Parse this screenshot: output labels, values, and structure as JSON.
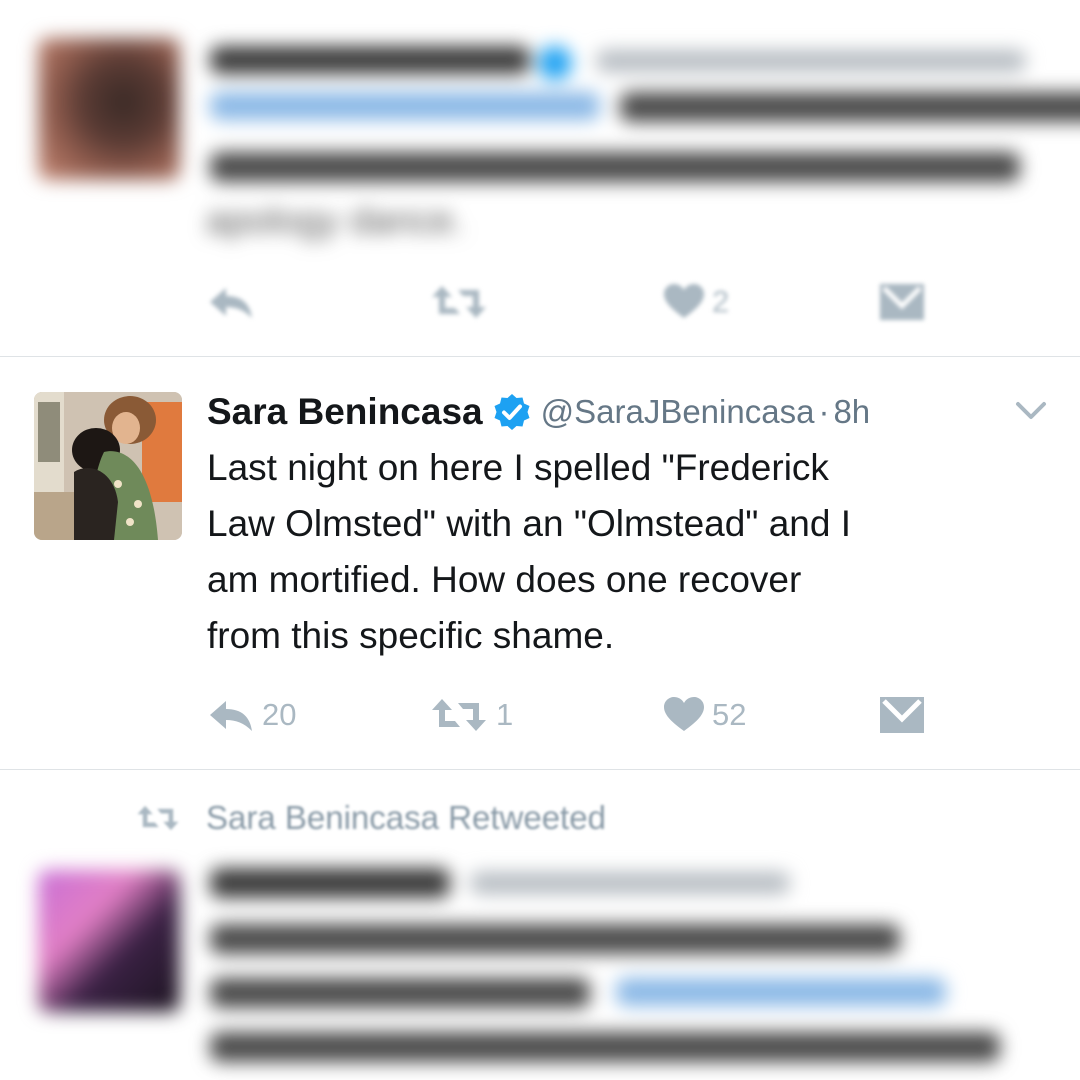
{
  "top_tweet": {
    "partial_text": "apology dance.",
    "actions": {
      "reply": "",
      "retweet": "",
      "like": "2"
    }
  },
  "main_tweet": {
    "author_name": "Sara Benincasa",
    "handle": "@SaraJBenincasa",
    "separator": "·",
    "time": "8h",
    "text": "Last night on here I spelled \"Frederick\nLaw Olmsted\" with an \"Olmstead\" and I\nam mortified. How does one recover\nfrom this specific shame.",
    "actions": {
      "reply_count": "20",
      "retweet_count": "1",
      "like_count": "52"
    }
  },
  "retweet_context": {
    "label": "Sara Benincasa Retweeted"
  },
  "colors": {
    "text": "#14171a",
    "muted": "#657786",
    "action_gray": "#aab8c2",
    "verified_blue": "#1da1f2",
    "divider": "#dfe3e6"
  },
  "icons": [
    "reply-icon",
    "retweet-icon",
    "like-icon",
    "direct-message-icon",
    "verified-badge-icon",
    "chevron-down-icon"
  ]
}
